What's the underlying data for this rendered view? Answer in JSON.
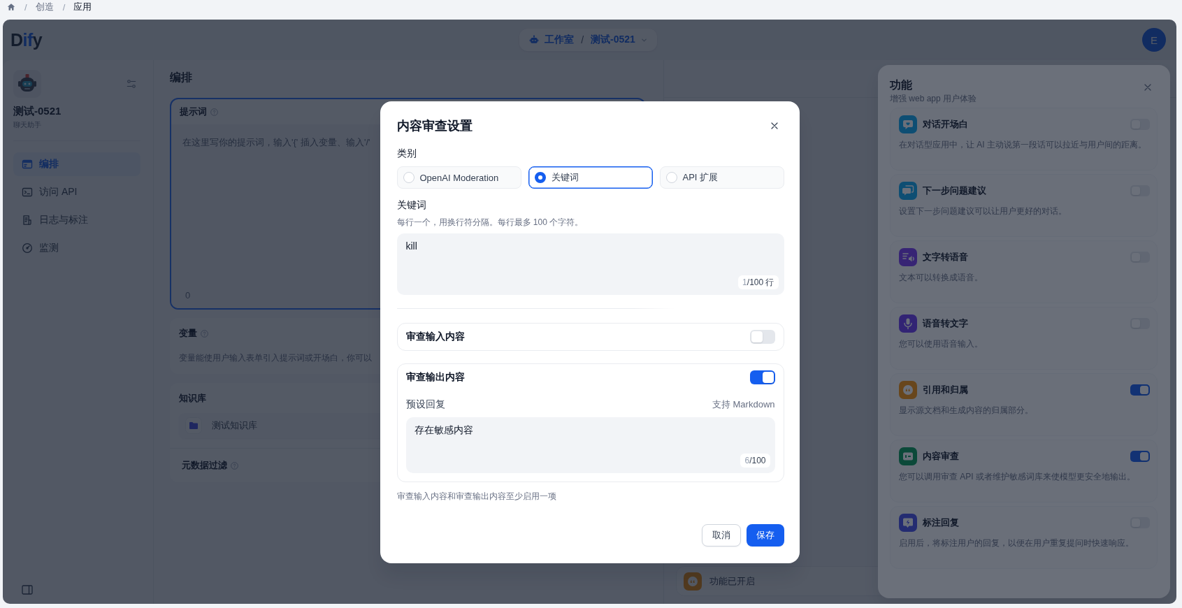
{
  "breadcrumb": {
    "items": [
      {
        "separator": "/",
        "label": "创造",
        "current": false
      },
      {
        "separator": "/",
        "label": "应用",
        "current": true
      }
    ]
  },
  "header": {
    "logo": "Dify",
    "workspace": "工作室",
    "separator": "/",
    "app_name": "测试-0521",
    "avatar": "E"
  },
  "sidebar": {
    "app_name": "测试-0521",
    "app_type": "聊天助手",
    "items": [
      {
        "label": "编排",
        "selected": true
      },
      {
        "label": "访问 API",
        "selected": false
      },
      {
        "label": "日志与标注",
        "selected": false
      },
      {
        "label": "监测",
        "selected": false
      }
    ]
  },
  "editor": {
    "title": "编排",
    "prompt": {
      "title": "提示词",
      "placeholder": "在这里写你的提示词，输入'{' 插入变量、输入'/'",
      "count": "0"
    },
    "variables": {
      "title": "变量",
      "description": "变量能使用户输入表单引入提示词或开场白，你可以"
    },
    "knowledge": {
      "title": "知识库",
      "items": [
        {
          "name": "测试知识库"
        }
      ],
      "metadata_filter": "元数据过滤"
    }
  },
  "debug": {
    "features_status": "功能已开启"
  },
  "features_panel": {
    "title": "功能",
    "subtitle": "增强 web app 用户体验",
    "items": [
      {
        "title": "对话开场白",
        "description": "在对话型应用中，让 AI 主动说第一段话可以拉近与用户间的距离。",
        "on": false
      },
      {
        "title": "下一步问题建议",
        "description": "设置下一步问题建议可以让用户更好的对话。",
        "on": false
      },
      {
        "title": "文字转语音",
        "description": "文本可以转换成语音。",
        "on": false
      },
      {
        "title": "语音转文字",
        "description": "您可以使用语音输入。",
        "on": false
      },
      {
        "title": "引用和归属",
        "description": "显示源文档和生成内容的归属部分。",
        "on": true
      },
      {
        "title": "内容审查",
        "description": "您可以调用审查 API 或者维护敏感词库来使模型更安全地输出。",
        "on": true
      },
      {
        "title": "标注回复",
        "description": "启用后，将标注用户的回复，以便在用户重复提问时快速响应。",
        "on": false
      }
    ]
  },
  "modal": {
    "title": "内容审查设置",
    "category_label": "类别",
    "categories": [
      {
        "label": "OpenAI Moderation",
        "selected": false
      },
      {
        "label": "关键词",
        "selected": true
      },
      {
        "label": "API 扩展",
        "selected": false
      }
    ],
    "keywords": {
      "label": "关键词",
      "hint": "每行一个，用换行符分隔。每行最多 100 个字符。",
      "value": "kill",
      "count": "1",
      "limit": "/100 行"
    },
    "input_review": {
      "label": "审查输入内容",
      "on": false
    },
    "output_review": {
      "label": "审查输出内容",
      "on": true,
      "preset_label": "预设回复",
      "markdown_note": "支持 Markdown",
      "value": "存在敏感内容",
      "count": "6",
      "limit": "/100"
    },
    "note": "审查输入内容和审查输出内容至少启用一项",
    "buttons": {
      "cancel": "取消",
      "save": "保存"
    }
  }
}
